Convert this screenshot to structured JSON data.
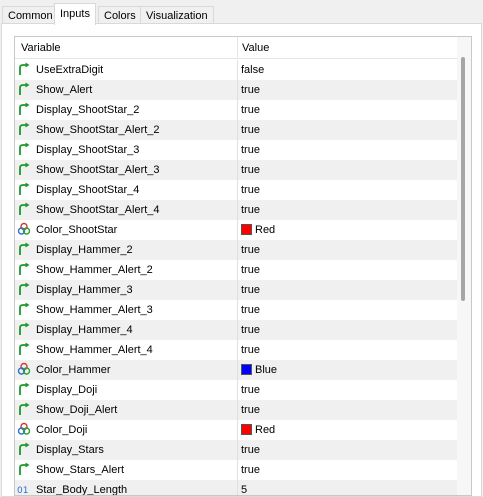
{
  "tabs": [
    {
      "label": "Common"
    },
    {
      "label": "Inputs"
    },
    {
      "label": "Colors"
    },
    {
      "label": "Visualization"
    }
  ],
  "grid": {
    "col_variable": "Variable",
    "col_value": "Value"
  },
  "colors": {
    "red": "#ff0000",
    "blue": "#0000ff"
  },
  "rows": [
    {
      "name": "UseExtraDigit",
      "value": "false",
      "icon": "green-arrow-icon"
    },
    {
      "name": "Show_Alert",
      "value": "true",
      "icon": "green-arrow-icon"
    },
    {
      "name": "Display_ShootStar_2",
      "value": "true",
      "icon": "green-arrow-icon"
    },
    {
      "name": "Show_ShootStar_Alert_2",
      "value": "true",
      "icon": "green-arrow-icon"
    },
    {
      "name": "Display_ShootStar_3",
      "value": "true",
      "icon": "green-arrow-icon"
    },
    {
      "name": "Show_ShootStar_Alert_3",
      "value": "true",
      "icon": "green-arrow-icon"
    },
    {
      "name": "Display_ShootStar_4",
      "value": "true",
      "icon": "green-arrow-icon"
    },
    {
      "name": "Show_ShootStar_Alert_4",
      "value": "true",
      "icon": "green-arrow-icon"
    },
    {
      "name": "Color_ShootStar",
      "value": "Red",
      "icon": "color-circles-icon",
      "swatch": "#ff0000"
    },
    {
      "name": "Display_Hammer_2",
      "value": "true",
      "icon": "green-arrow-icon"
    },
    {
      "name": "Show_Hammer_Alert_2",
      "value": "true",
      "icon": "green-arrow-icon"
    },
    {
      "name": "Display_Hammer_3",
      "value": "true",
      "icon": "green-arrow-icon"
    },
    {
      "name": "Show_Hammer_Alert_3",
      "value": "true",
      "icon": "green-arrow-icon"
    },
    {
      "name": "Display_Hammer_4",
      "value": "true",
      "icon": "green-arrow-icon"
    },
    {
      "name": "Show_Hammer_Alert_4",
      "value": "true",
      "icon": "green-arrow-icon"
    },
    {
      "name": "Color_Hammer",
      "value": "Blue",
      "icon": "color-circles-icon",
      "swatch": "#0000ff"
    },
    {
      "name": "Display_Doji",
      "value": "true",
      "icon": "green-arrow-icon"
    },
    {
      "name": "Show_Doji_Alert",
      "value": "true",
      "icon": "green-arrow-icon"
    },
    {
      "name": "Color_Doji",
      "value": "Red",
      "icon": "color-circles-icon",
      "swatch": "#ff0000"
    },
    {
      "name": "Display_Stars",
      "value": "true",
      "icon": "green-arrow-icon"
    },
    {
      "name": "Show_Stars_Alert",
      "value": "true",
      "icon": "green-arrow-icon"
    },
    {
      "name": "Star_Body_Length",
      "value": "5",
      "icon": "number-icon"
    }
  ]
}
